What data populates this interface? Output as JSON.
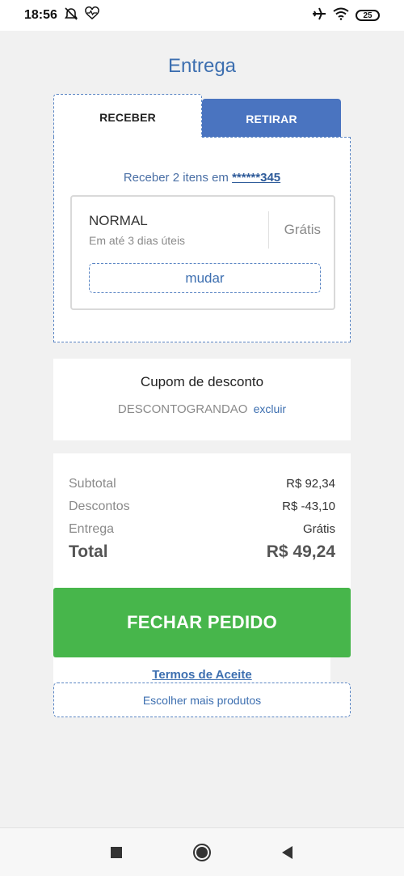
{
  "status_bar": {
    "time": "18:56",
    "battery": "25",
    "icons": [
      "alarm-off-icon",
      "heart-rate-icon",
      "airplane-icon",
      "wifi-icon",
      "battery-icon"
    ]
  },
  "page": {
    "title": "Entrega"
  },
  "tabs": [
    {
      "label": "RECEBER",
      "active": true
    },
    {
      "label": "RETIRAR",
      "active": false
    }
  ],
  "delivery": {
    "receive_text": "Receber 2 itens em ",
    "address_masked": "******345",
    "option": {
      "name": "NORMAL",
      "description": "Em até 3 dias úteis",
      "price": "Grátis",
      "change_label": "mudar"
    }
  },
  "coupon": {
    "title": "Cupom de desconto",
    "code": "DESCONTOGRANDAO",
    "remove_label": "excluir"
  },
  "summary": {
    "subtotal_label": "Subtotal",
    "subtotal_value": "R$ 92,34",
    "discount_label": "Descontos",
    "discount_value": "R$ -43,10",
    "delivery_label": "Entrega",
    "delivery_value": "Grátis",
    "total_label": "Total",
    "total_value": "R$ 49,24"
  },
  "actions": {
    "checkout_label": "FECHAR PEDIDO",
    "terms_label": "Termos de Aceite",
    "more_products_label": "Escolher mais produtos"
  },
  "nav_bar": {
    "icons": [
      "recents-icon",
      "home-icon",
      "back-icon"
    ]
  },
  "colors": {
    "accent_blue": "#3d6fb0",
    "tab_blue": "#4a74c0",
    "checkout_green": "#47b64b",
    "background": "#f1f1f1"
  }
}
